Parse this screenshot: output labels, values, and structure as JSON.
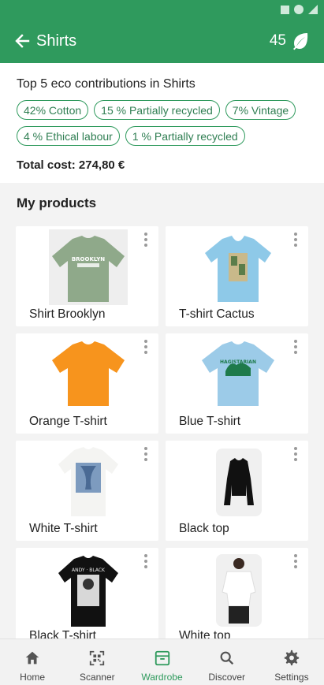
{
  "colors": {
    "primary": "#2f9a5d",
    "background": "#f3f3f3",
    "card": "#ffffff",
    "chip_border": "#2f9a5d"
  },
  "appbar": {
    "title": "Shirts",
    "score": "45",
    "back_icon": "arrow-left-icon",
    "score_icon": "leaf-icon"
  },
  "summary": {
    "title": "Top 5 eco contributions in Shirts",
    "chips": [
      "42% Cotton",
      "15 % Partially recycled",
      "7% Vintage",
      "4 % Ethical labour",
      "1 % Partially recycled"
    ],
    "total": "Total cost: 274,80 €"
  },
  "products_section": {
    "title": "My products"
  },
  "products": [
    {
      "name": "Shirt Brooklyn"
    },
    {
      "name": "T-shirt Cactus"
    },
    {
      "name": "Orange T-shirt"
    },
    {
      "name": "Blue T-shirt"
    },
    {
      "name": "White T-shirt"
    },
    {
      "name": "Black top"
    },
    {
      "name": "Black T-shirt"
    },
    {
      "name": "White top"
    }
  ],
  "bottom_nav": [
    {
      "label": "Home",
      "icon": "home-icon"
    },
    {
      "label": "Scanner",
      "icon": "qr-scanner-icon"
    },
    {
      "label": "Wardrobe",
      "icon": "wardrobe-icon",
      "active": true
    },
    {
      "label": "Discover",
      "icon": "search-icon"
    },
    {
      "label": "Settings",
      "icon": "gear-icon"
    }
  ]
}
